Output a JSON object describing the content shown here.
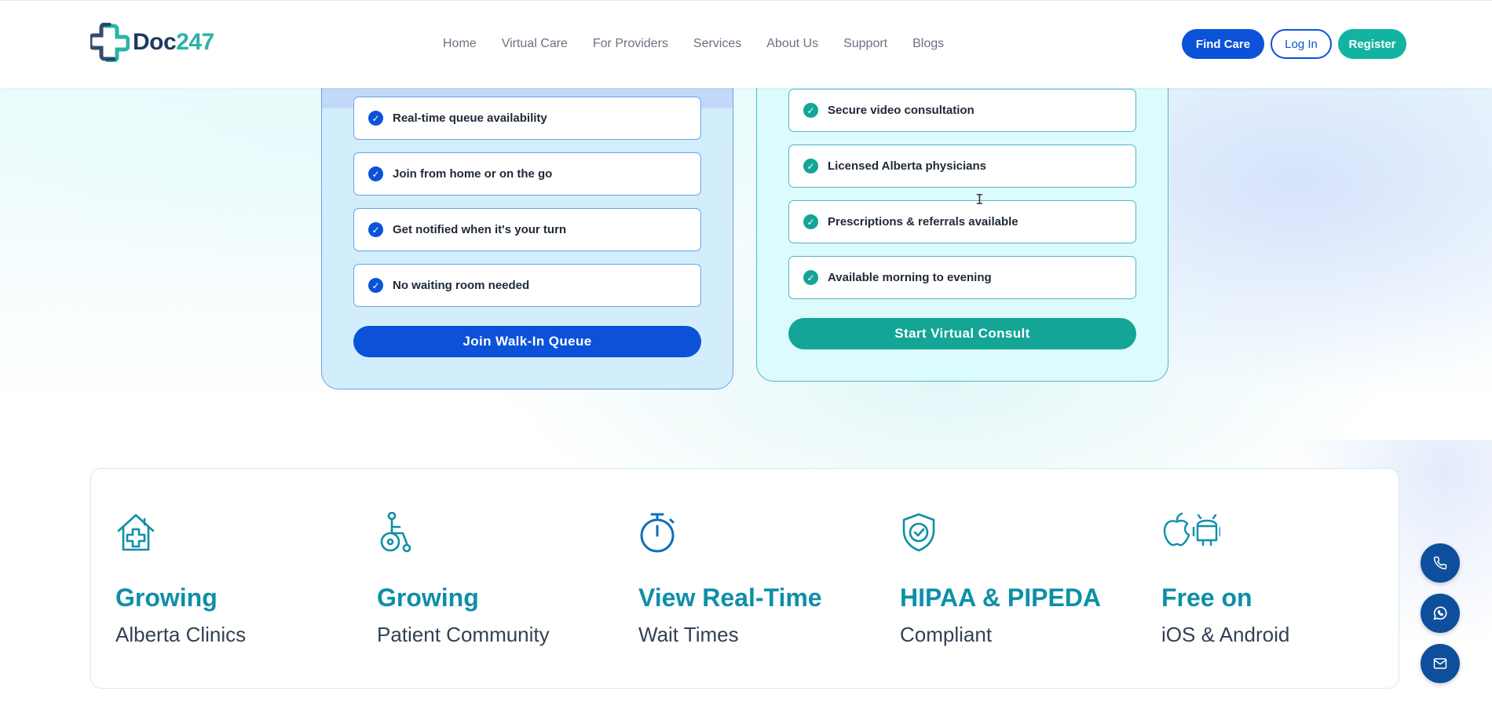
{
  "brand": {
    "logo_doc": "Doc",
    "logo_247": "247",
    "primary": "#0b52d9",
    "accent": "#13b3a2"
  },
  "nav": {
    "items": [
      "Home",
      "Virtual Care",
      "For Providers",
      "Services",
      "About Us",
      "Support",
      "Blogs"
    ]
  },
  "header_buttons": {
    "find_care": "Find Care",
    "login": "Log In",
    "register": "Register"
  },
  "walk_in_card": {
    "features": [
      "Real-time queue availability",
      "Join from home or on the go",
      "Get notified when it's your turn",
      "No waiting room needed"
    ],
    "cta": "Join Walk-In Queue"
  },
  "virtual_card": {
    "features": [
      "Secure video consultation",
      "Licensed Alberta physicians",
      "Prescriptions & referrals available",
      "Available morning to evening"
    ],
    "cta": "Start Virtual Consult"
  },
  "stats": [
    {
      "icon": "clinic-house-icon",
      "title": "Growing",
      "subtitle": "Alberta Clinics"
    },
    {
      "icon": "wheelchair-patient-icon",
      "title": "Growing",
      "subtitle": "Patient Community"
    },
    {
      "icon": "stopwatch-icon",
      "title": "View Real-Time",
      "subtitle": "Wait Times"
    },
    {
      "icon": "shield-check-icon",
      "title": "HIPAA & PIPEDA",
      "subtitle": "Compliant"
    },
    {
      "icon": "apple-android-icon",
      "title": "Free on",
      "subtitle": "iOS & Android"
    }
  ],
  "contact_fabs": [
    "phone-icon",
    "whatsapp-icon",
    "mail-icon"
  ]
}
